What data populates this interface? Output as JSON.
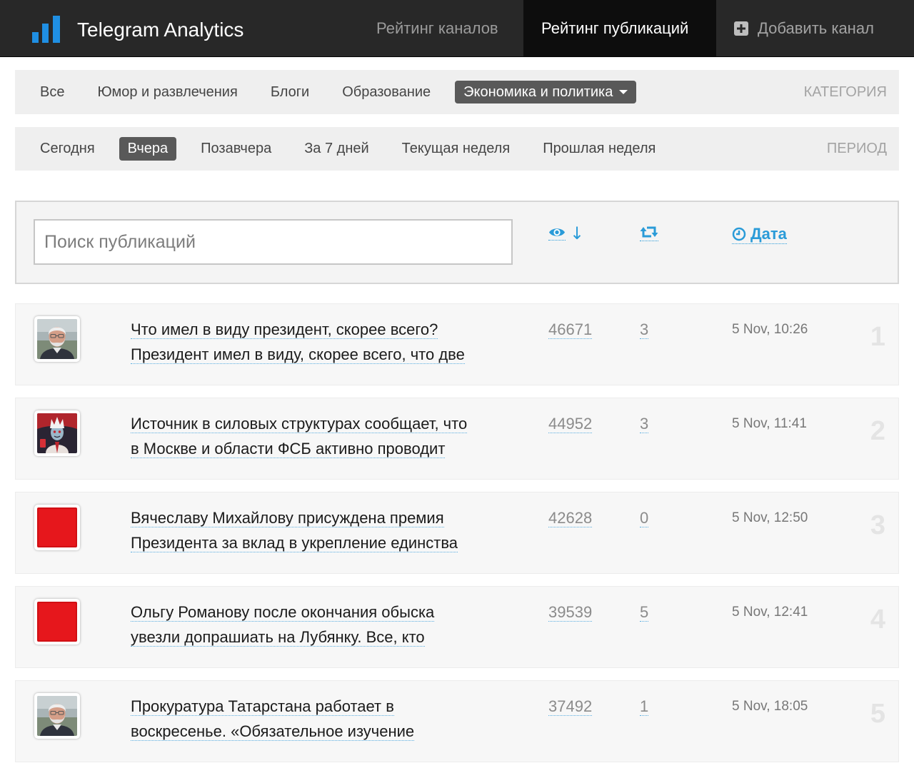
{
  "app": {
    "title": "Telegram Analytics",
    "logo_icon": "bar-chart-icon"
  },
  "colors": {
    "accent": "#2a9bd8",
    "logo": "#1f8fe3",
    "nav_background": "#282828",
    "nav_active_background": "#0d0d0d",
    "filter_active_background": "#595959"
  },
  "nav": {
    "items": [
      {
        "label": "Рейтинг каналов",
        "active": false
      },
      {
        "label": "Рейтинг публикаций",
        "active": true
      },
      {
        "label": "Добавить канал",
        "icon": "plus-square-icon",
        "active": false
      }
    ]
  },
  "category_filter": {
    "label": "КАТЕГОРИЯ",
    "items": [
      {
        "label": "Все",
        "active": false
      },
      {
        "label": "Юмор и развлечения",
        "active": false
      },
      {
        "label": "Блоги",
        "active": false
      },
      {
        "label": "Образование",
        "active": false
      },
      {
        "label": "Экономика и политика",
        "active": true,
        "icon": "caret-down-icon"
      }
    ]
  },
  "period_filter": {
    "label": "ПЕРИОД",
    "items": [
      {
        "label": "Сегодня",
        "active": false
      },
      {
        "label": "Вчера",
        "active": true
      },
      {
        "label": "Позавчера",
        "active": false
      },
      {
        "label": "За 7 дней",
        "active": false
      },
      {
        "label": "Текущая неделя",
        "active": false
      },
      {
        "label": "Прошлая неделя",
        "active": false
      }
    ]
  },
  "search": {
    "placeholder": "Поиск публикаций",
    "value": ""
  },
  "sort": {
    "views": {
      "icon": "eye-icon",
      "arrow": "↓",
      "active": true
    },
    "reposts": {
      "icon": "retweet-icon"
    },
    "date": {
      "icon": "clock-icon",
      "label": "Дата"
    }
  },
  "posts": [
    {
      "rank": "1",
      "avatar_icon": "bearded-man-avatar",
      "title_lines": [
        "Что имел в виду президент, скорее всего?",
        "Президент имел в виду, скорее всего, что две"
      ],
      "views": "46671",
      "reposts": "3",
      "date": "5 Nov, 10:26"
    },
    {
      "rank": "2",
      "avatar_icon": "illustrated-character-avatar",
      "title_lines": [
        "Источник в силовых структурах сообщает, что",
        "в Москве и области ФСБ активно проводит"
      ],
      "views": "44952",
      "reposts": "3",
      "date": "5 Nov, 11:41"
    },
    {
      "rank": "3",
      "avatar_icon": "red-square-avatar",
      "title_lines": [
        "Вячеславу Михайлову присуждена премия",
        "Президента за вклад в укрепление единства"
      ],
      "views": "42628",
      "reposts": "0",
      "date": "5 Nov, 12:50"
    },
    {
      "rank": "4",
      "avatar_icon": "red-square-avatar",
      "title_lines": [
        "Ольгу Романову после окончания обыска",
        "увезли допрашиать на Лубянку. Все, кто"
      ],
      "views": "39539",
      "reposts": "5",
      "date": "5 Nov, 12:41"
    },
    {
      "rank": "5",
      "avatar_icon": "bearded-man-avatar",
      "title_lines": [
        "Прокуратура Татарстана работает в",
        "воскресенье. «Обязательное изучение"
      ],
      "views": "37492",
      "reposts": "1",
      "date": "5 Nov, 18:05"
    }
  ]
}
